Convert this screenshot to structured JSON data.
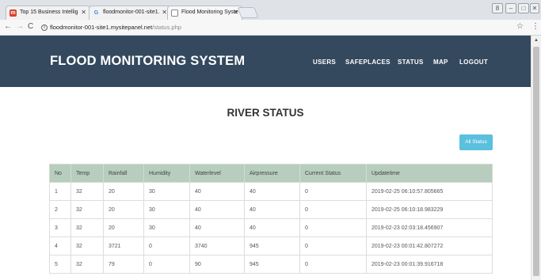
{
  "browser": {
    "tabs": [
      {
        "title": "Top 15 Business Intellig",
        "icon": "brand-favicon-icon"
      },
      {
        "title": "floodmonitor-001-site1.",
        "icon": "google-favicon-icon"
      },
      {
        "title": "Flood Monitoring Syste",
        "icon": "page-favicon-icon"
      }
    ],
    "url_domain": "floodmonitor-001-site1.mysitepanel.net",
    "url_path": "/status.php"
  },
  "site": {
    "brand": "FLOOD MONITORING SYSTEM",
    "nav": [
      "USERS",
      "SAFEPLACES",
      "STATUS",
      "MAP",
      "LOGOUT"
    ]
  },
  "main": {
    "title": "RIVER STATUS",
    "all_status_label": "All Status",
    "table": {
      "columns": [
        "No",
        "Temp",
        "Rainfall",
        "Humidity",
        "Waterlevel",
        "Airpressure",
        "Current Status",
        "Updatetime"
      ],
      "rows": [
        [
          "1",
          "32",
          "20",
          "30",
          "40",
          "40",
          "0",
          "2019-02-25 06:10:57.805665"
        ],
        [
          "2",
          "32",
          "20",
          "30",
          "40",
          "40",
          "0",
          "2019-02-25 06:10:18.983229"
        ],
        [
          "3",
          "32",
          "20",
          "30",
          "40",
          "40",
          "0",
          "2019-02-23 02:03:18.456907"
        ],
        [
          "4",
          "32",
          "3721",
          "0",
          "3740",
          "945",
          "0",
          "2019-02-23 00:01:42.807272"
        ],
        [
          "5",
          "32",
          "79",
          "0",
          "90",
          "945",
          "0",
          "2019-02-23 00:01:39.916718"
        ]
      ]
    }
  },
  "colors": {
    "navbar": "#34495e",
    "table_header": "#b7cdbd",
    "button": "#5bc0de"
  }
}
